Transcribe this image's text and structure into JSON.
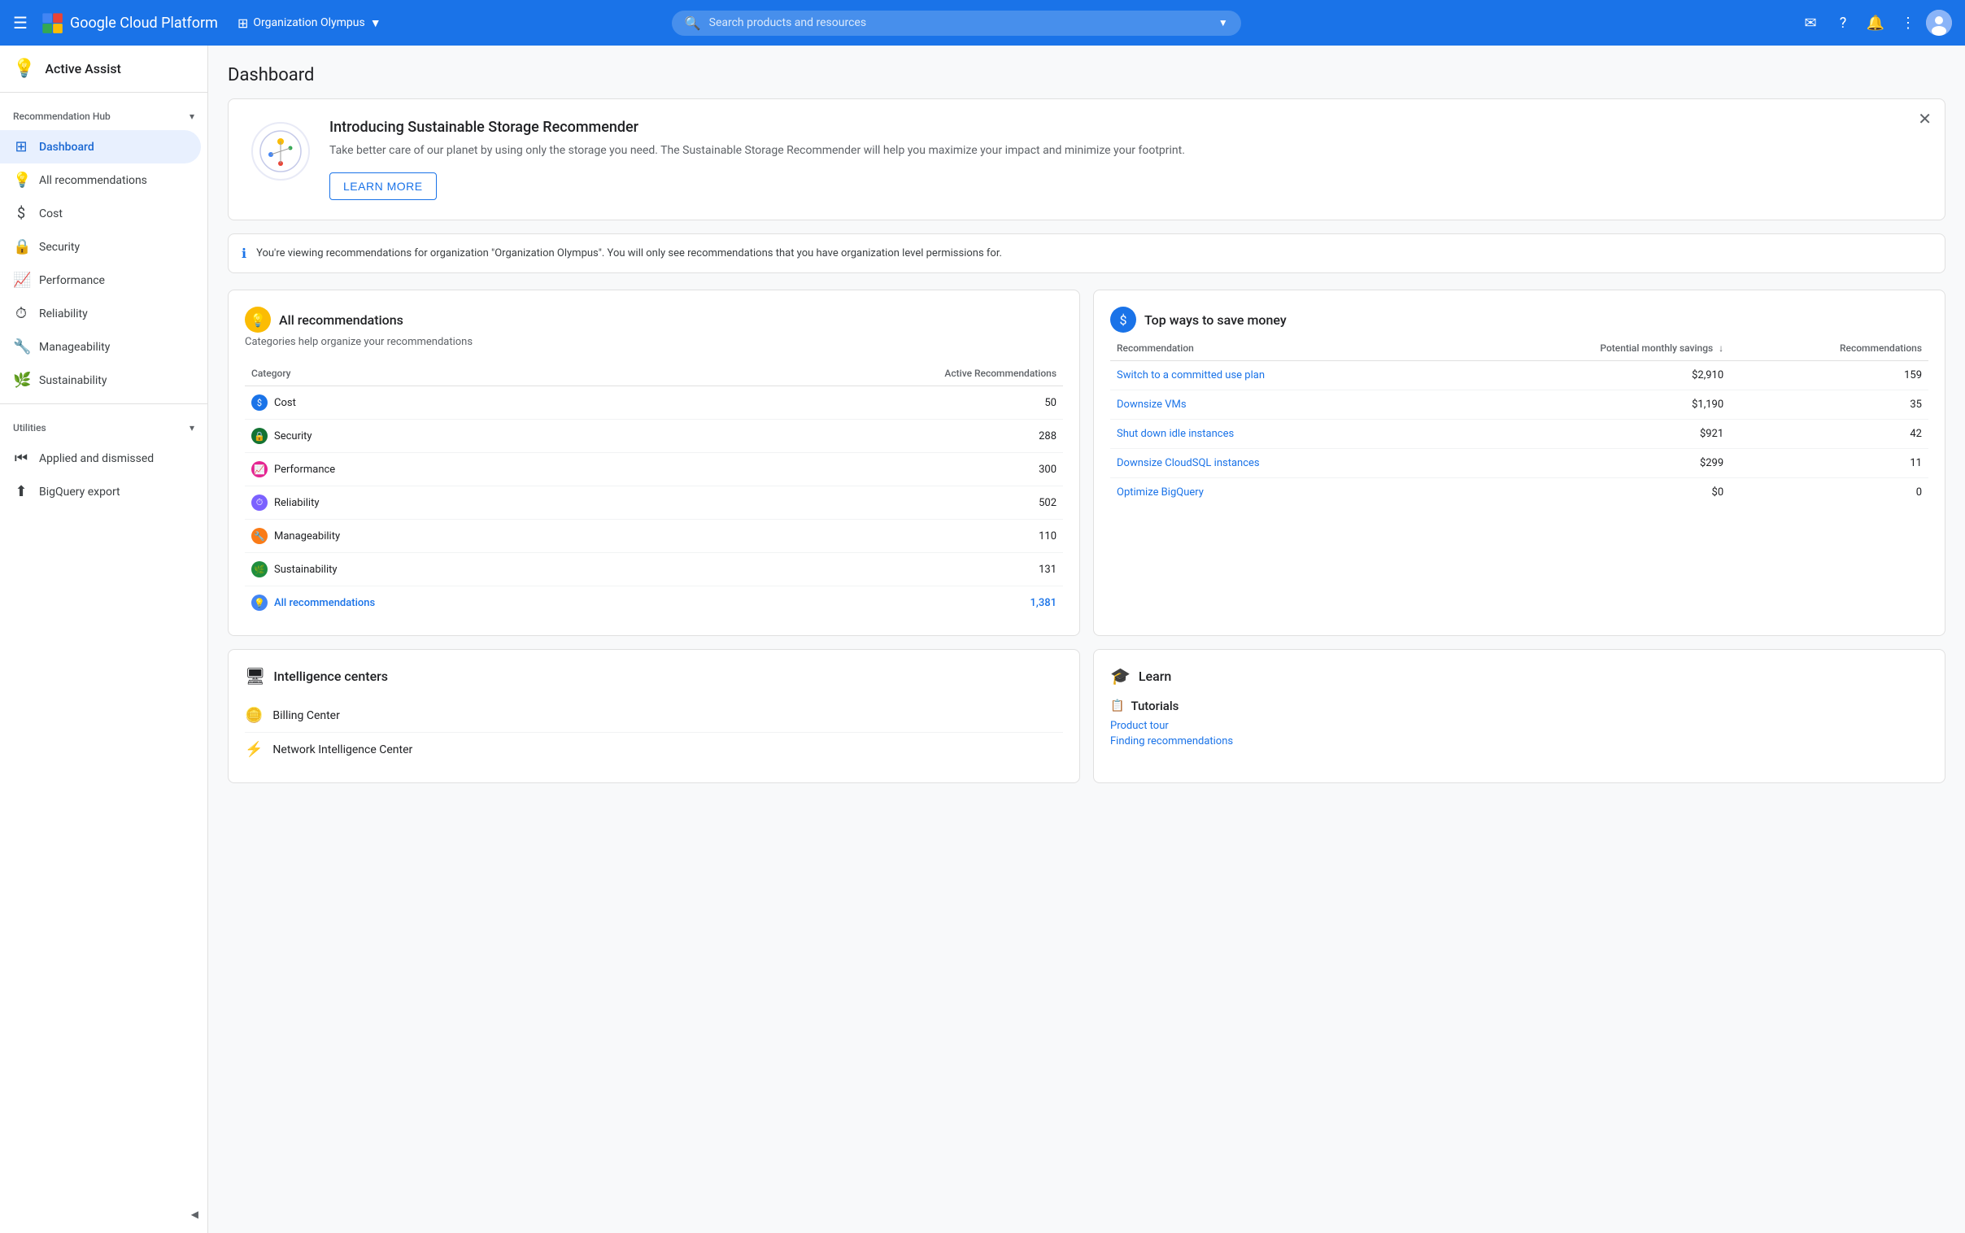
{
  "topnav": {
    "hamburger": "☰",
    "logo": "Google Cloud Platform",
    "org": "Organization Olympus",
    "org_icon": "⊞",
    "search_placeholder": "Search products and resources",
    "search_chevron": "▼",
    "icons": [
      "✉",
      "?",
      "🔔",
      "⋮"
    ]
  },
  "sidebar": {
    "brand": "Active Assist",
    "brand_icon": "💡",
    "section1": {
      "title": "Recommendation Hub",
      "items": [
        {
          "id": "dashboard",
          "label": "Dashboard",
          "icon": "⊞",
          "active": true
        },
        {
          "id": "all-recommendations",
          "label": "All recommendations",
          "icon": "💡"
        }
      ]
    },
    "section2": {
      "items": [
        {
          "id": "cost",
          "label": "Cost",
          "icon": "$"
        },
        {
          "id": "security",
          "label": "Security",
          "icon": "🔒"
        },
        {
          "id": "performance",
          "label": "Performance",
          "icon": "📈"
        },
        {
          "id": "reliability",
          "label": "Reliability",
          "icon": "⏱"
        },
        {
          "id": "manageability",
          "label": "Manageability",
          "icon": "🔧"
        },
        {
          "id": "sustainability",
          "label": "Sustainability",
          "icon": "🌿"
        }
      ]
    },
    "utilities": {
      "title": "Utilities",
      "items": [
        {
          "id": "applied-dismissed",
          "label": "Applied and dismissed",
          "icon": "⏮"
        },
        {
          "id": "bigquery-export",
          "label": "BigQuery export",
          "icon": "⬆"
        }
      ]
    },
    "collapse_icon": "◀"
  },
  "main": {
    "page_title": "Dashboard",
    "banner": {
      "title": "Introducing Sustainable Storage Recommender",
      "desc": "Take better care of our planet by using only the storage you need. The Sustainable Storage Recommender will help you maximize your impact and minimize your footprint.",
      "button_label": "LEARN MORE",
      "close": "✕"
    },
    "info_bar": {
      "icon": "ℹ",
      "text": "You're viewing recommendations for organization \"Organization Olympus\". You will only see recommendations that you have organization level permissions for."
    },
    "all_recommendations": {
      "title": "All recommendations",
      "subtitle": "Categories help organize your recommendations",
      "icon": "💡",
      "table": {
        "headers": [
          "Category",
          "Active Recommendations"
        ],
        "rows": [
          {
            "category": "Cost",
            "icon": "$",
            "icon_class": "cat-blue",
            "count": "50"
          },
          {
            "category": "Security",
            "icon": "🔒",
            "icon_class": "cat-teal",
            "count": "288"
          },
          {
            "category": "Performance",
            "icon": "📈",
            "icon_class": "cat-pink",
            "count": "300"
          },
          {
            "category": "Reliability",
            "icon": "⏱",
            "icon_class": "cat-purple",
            "count": "502"
          },
          {
            "category": "Manageability",
            "icon": "🔧",
            "icon_class": "cat-orange",
            "count": "110"
          },
          {
            "category": "Sustainability",
            "icon": "🌿",
            "icon_class": "cat-green",
            "count": "131"
          },
          {
            "category": "All recommendations",
            "icon": "💡",
            "icon_class": "cat-lightblue",
            "count": "1,381",
            "all": true
          }
        ]
      }
    },
    "top_savings": {
      "title": "Top ways to save money",
      "icon": "$",
      "table": {
        "headers": [
          "Recommendation",
          "Potential monthly savings",
          "Recommendations"
        ],
        "rows": [
          {
            "name": "Switch to a committed use plan",
            "savings": "$2,910",
            "count": "159"
          },
          {
            "name": "Downsize VMs",
            "savings": "$1,190",
            "count": "35"
          },
          {
            "name": "Shut down idle instances",
            "savings": "$921",
            "count": "42"
          },
          {
            "name": "Downsize CloudSQL instances",
            "savings": "$299",
            "count": "11"
          },
          {
            "name": "Optimize BigQuery",
            "savings": "$0",
            "count": "0"
          }
        ]
      }
    },
    "intelligence_centers": {
      "title": "Intelligence centers",
      "icon": "🖥",
      "items": [
        {
          "id": "billing-center",
          "label": "Billing Center",
          "icon": "🪙"
        },
        {
          "id": "network-intelligence",
          "label": "Network Intelligence Center",
          "icon": "⚡"
        }
      ]
    },
    "learn": {
      "title": "Learn",
      "icon": "🎓",
      "tutorials": {
        "title": "Tutorials",
        "icon": "📋",
        "links": [
          {
            "id": "product-tour",
            "label": "Product tour"
          },
          {
            "id": "finding-recommendations",
            "label": "Finding recommendations"
          }
        ]
      }
    }
  }
}
